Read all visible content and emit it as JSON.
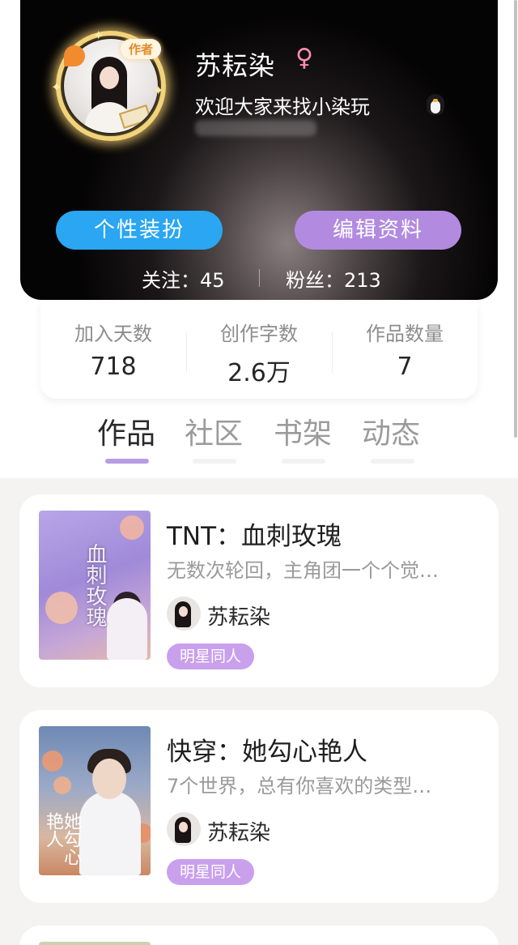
{
  "profile": {
    "author_badge": "作者",
    "username": "苏耘染",
    "gender_symbol": "♀",
    "bio": "欢迎大家来找小染玩",
    "dress_up_button": "个性装扮",
    "edit_profile_button": "编辑资料",
    "following_label": "关注：45",
    "followers_label": "粉丝：213"
  },
  "stats": [
    {
      "label": "加入天数",
      "value": "718"
    },
    {
      "label": "创作字数",
      "value": "2.6万"
    },
    {
      "label": "作品数量",
      "value": "7"
    }
  ],
  "tabs": [
    {
      "label": "作品",
      "active": true
    },
    {
      "label": "社区",
      "active": false
    },
    {
      "label": "书架",
      "active": false
    },
    {
      "label": "动态",
      "active": false
    }
  ],
  "works": [
    {
      "title": "TNT：血刺玫瑰",
      "description": "无数次轮回，主角团一个个觉…",
      "author": "苏耘染",
      "tag": "明星同人",
      "cover_text": "血刺玫瑰"
    },
    {
      "title": "快穿：她勾心艳人",
      "description": "7个世界，总有你喜欢的类型…",
      "author": "苏耘染",
      "tag": "明星同人",
      "cover_text": "她勾心艳人"
    }
  ],
  "colors": {
    "dress_up_button": "#2aa6f2",
    "edit_button": "#b28be0",
    "tab_indicator": "#b89ce2",
    "tag": "#c9a0ec",
    "gender": "#ff8fb2"
  },
  "icons": {
    "penguin": "qq-penguin-icon",
    "gender": "female-symbol-icon"
  }
}
